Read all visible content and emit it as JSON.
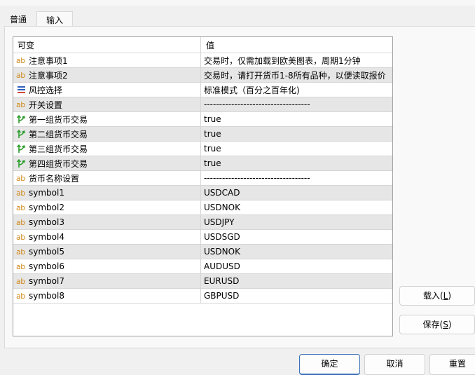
{
  "tabs": [
    {
      "label": "普通",
      "active": false
    },
    {
      "label": "输入",
      "active": true
    }
  ],
  "table": {
    "columns": [
      "可变",
      "值"
    ],
    "rows": [
      {
        "icon": "ab",
        "name": "注意事项1",
        "value": "交易时，仅需加载到欧美图表，周期1分钟"
      },
      {
        "icon": "ab",
        "name": "注意事项2",
        "value": "交易时，请打开货币1-8所有品种，以便读取报价"
      },
      {
        "icon": "enum",
        "name": "风控选择",
        "value": "标准模式（百分之百年化)"
      },
      {
        "icon": "ab",
        "name": "开关设置",
        "value": "-----------------------------------"
      },
      {
        "icon": "bool",
        "name": "第一组货币交易",
        "value": "true"
      },
      {
        "icon": "bool",
        "name": "第二组货币交易",
        "value": "true"
      },
      {
        "icon": "bool",
        "name": "第三组货币交易",
        "value": "true"
      },
      {
        "icon": "bool",
        "name": "第四组货币交易",
        "value": "true"
      },
      {
        "icon": "ab",
        "name": "货币名称设置",
        "value": "-----------------------------------"
      },
      {
        "icon": "ab",
        "name": "symbol1",
        "value": "USDCAD"
      },
      {
        "icon": "ab",
        "name": "symbol2",
        "value": "USDNOK"
      },
      {
        "icon": "ab",
        "name": "symbol3",
        "value": "USDJPY"
      },
      {
        "icon": "ab",
        "name": "symbol4",
        "value": "USDSGD"
      },
      {
        "icon": "ab",
        "name": "symbol5",
        "value": "USDNOK"
      },
      {
        "icon": "ab",
        "name": "symbol6",
        "value": "AUDUSD"
      },
      {
        "icon": "ab",
        "name": "symbol7",
        "value": "EURUSD"
      },
      {
        "icon": "ab",
        "name": "symbol8",
        "value": "GBPUSD"
      }
    ]
  },
  "side_buttons": {
    "load": {
      "text": "载入(",
      "key": "L",
      "end": ")"
    },
    "save": {
      "text": "保存(",
      "key": "S",
      "end": ")"
    }
  },
  "bottom_buttons": {
    "ok": "确定",
    "cancel": "取消",
    "reset": "重置"
  },
  "colors": {
    "ab_icon": "#d08a1a",
    "bool_icon": "#2a9d2a",
    "enum_icon_top": "#2f5fbf",
    "enum_icon_bottom": "#d9443a",
    "row_alt": "#e6e6e6",
    "primary_button_border": "#3b6fb6"
  }
}
